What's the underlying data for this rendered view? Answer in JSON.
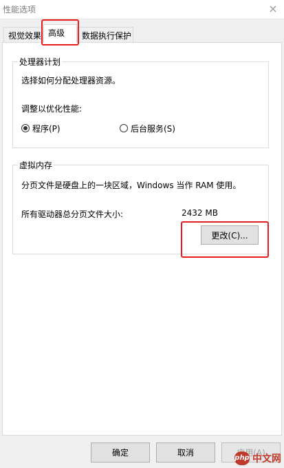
{
  "window": {
    "title": "性能选项",
    "close_glyph": "×"
  },
  "tabs": [
    {
      "label": "视觉效果",
      "active": false
    },
    {
      "label": "高级",
      "active": true
    },
    {
      "label": "数据执行保护",
      "active": false
    }
  ],
  "processor": {
    "group_title": "处理器计划",
    "description": "选择如何分配处理器资源。",
    "adjust_label": "调整以优化性能:",
    "options": [
      {
        "label": "程序(P)",
        "selected": true
      },
      {
        "label": "后台服务(S)",
        "selected": false
      }
    ]
  },
  "virtual_memory": {
    "group_title": "虚拟内存",
    "description": "分页文件是硬盘上的一块区域，Windows 当作 RAM 使用。",
    "total_label": "所有驱动器总分页文件大小:",
    "total_value": "2432 MB",
    "change_button": "更改(C)..."
  },
  "footer": {
    "ok": "确定",
    "cancel": "取消",
    "apply": "应用(A)"
  },
  "watermark": {
    "badge": "php",
    "text": "中文网"
  },
  "colors": {
    "highlight": "#e81c1c",
    "tab_panel": "#ffffff",
    "background": "#f0f0f0"
  }
}
